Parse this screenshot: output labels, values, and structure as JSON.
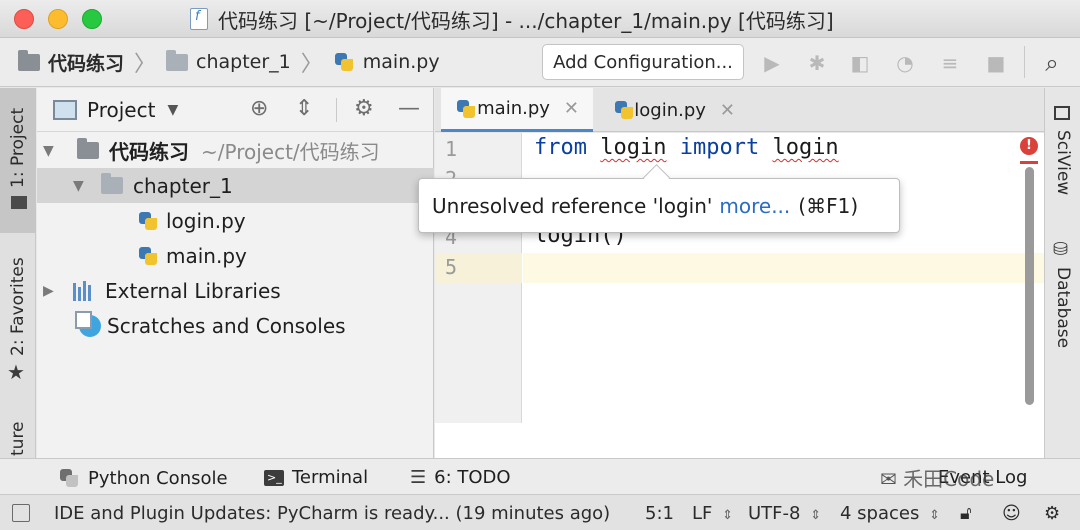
{
  "window": {
    "title": "代码练习 [~/Project/代码练习] - .../chapter_1/main.py [代码练习]"
  },
  "navbar": {
    "crumbs": [
      "代码练习",
      "chapter_1",
      "main.py"
    ],
    "add_configuration": "Add Configuration..."
  },
  "left_strip": {
    "project": "1: Project",
    "favorites": "2: Favorites",
    "structure": "ture"
  },
  "project_panel": {
    "title": "Project",
    "root": "代码练习",
    "root_path": "~/Project/代码练习",
    "folder": "chapter_1",
    "files": [
      "login.py",
      "main.py"
    ],
    "external_libraries": "External Libraries",
    "scratches": "Scratches and Consoles"
  },
  "editor": {
    "tabs": [
      "main.py",
      "login.py"
    ],
    "active_tab": "main.py",
    "line_numbers": [
      "1",
      "2",
      "4",
      "5"
    ],
    "code": {
      "line1_from": "from",
      "line1_module": "login",
      "line1_import": "import",
      "line1_name": "login",
      "line4": "login()"
    }
  },
  "tooltip": {
    "message": "Unresolved reference 'login'",
    "link": "more...",
    "shortcut": "(⌘F1)"
  },
  "right_strip": {
    "sciview": "SciView",
    "database": "Database"
  },
  "bottom_tools": {
    "python_console": "Python Console",
    "terminal": "Terminal",
    "todo": "6: TODO",
    "event_log": "Event Log",
    "watermark": "禾田Code"
  },
  "status": {
    "message": "IDE and Plugin Updates: PyCharm is ready... (19 minutes ago)",
    "position": "5:1",
    "line_sep": "LF",
    "encoding": "UTF-8",
    "indent": "4 spaces"
  },
  "colors": {
    "keyword": "#0a3fa0",
    "error": "#d9413a",
    "link": "#2b6cc4",
    "current_line": "#fdf9e3"
  }
}
